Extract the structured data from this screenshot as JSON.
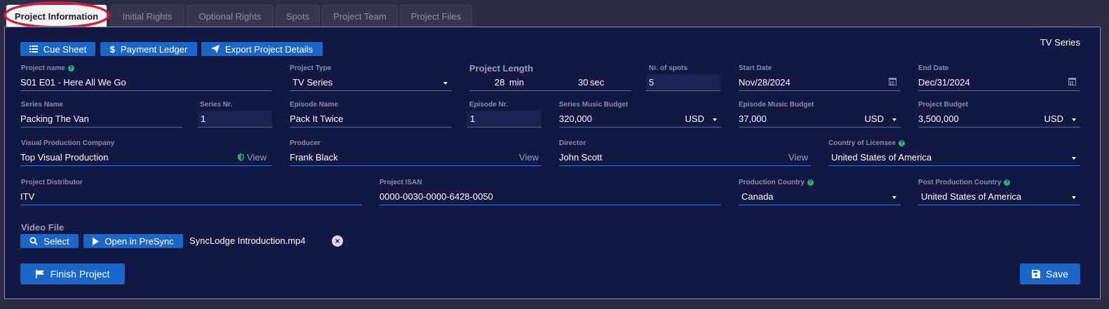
{
  "tabs": [
    {
      "label": "Project Information",
      "active": true
    },
    {
      "label": "Initial Rights"
    },
    {
      "label": "Optional Rights"
    },
    {
      "label": "Spots"
    },
    {
      "label": "Project Team"
    },
    {
      "label": "Project Files"
    }
  ],
  "toolbar": {
    "cue_sheet": "Cue Sheet",
    "payment_ledger": "Payment Ledger",
    "export": "Export Project Details"
  },
  "project_kind": "TV Series",
  "fields": {
    "project_name": {
      "label": "Project name",
      "value": "S01 E01 - Here All We Go"
    },
    "project_type": {
      "label": "Project Type",
      "value": "TV Series"
    },
    "project_length": {
      "label": "Project Length",
      "minutes": "28",
      "min_unit": "min",
      "seconds": "30",
      "sec_unit": "sec"
    },
    "nr_spots": {
      "label": "Nr. of spots",
      "value": "5"
    },
    "start_date": {
      "label": "Start Date",
      "value": "Nov/28/2024"
    },
    "end_date": {
      "label": "End Date",
      "value": "Dec/31/2024"
    },
    "series_name": {
      "label": "Series Name",
      "value": "Packing The Van"
    },
    "series_nr": {
      "label": "Series Nr.",
      "value": "1"
    },
    "episode_name": {
      "label": "Episode Name",
      "value": "Pack It Twice"
    },
    "episode_nr": {
      "label": "Episode Nr.",
      "value": "1"
    },
    "series_music_budget": {
      "label": "Series Music Budget",
      "value": "320,000",
      "currency": "USD"
    },
    "episode_music_budget": {
      "label": "Episode Music Budget",
      "value": "37,000",
      "currency": "USD"
    },
    "project_budget": {
      "label": "Project Budget",
      "value": "3,500,000",
      "currency": "USD"
    },
    "visual_production_company": {
      "label": "Visual Production Company",
      "value": "Top Visual Production",
      "action": "View"
    },
    "producer": {
      "label": "Producer",
      "value": "Frank Black",
      "action": "View"
    },
    "director": {
      "label": "Director",
      "value": "John Scott",
      "action": "View"
    },
    "country_of_licensee": {
      "label": "Country of Licensee",
      "value": "United States of America"
    },
    "project_distributor": {
      "label": "Project Distributor",
      "value": "ITV"
    },
    "project_isan": {
      "label": "Project ISAN",
      "value": "0000-0030-0000-6428-0050"
    },
    "production_country": {
      "label": "Production Country",
      "value": "Canada"
    },
    "post_production_country": {
      "label": "Post Production Country",
      "value": "United States of America"
    }
  },
  "video": {
    "label": "Video File",
    "select": "Select",
    "open": "Open in PreSync",
    "filename": "SyncLodge Introduction.mp4"
  },
  "footer": {
    "finish": "Finish Project",
    "save": "Save"
  },
  "colors": {
    "accent": "#1a67c9",
    "panel": "#111844",
    "highlight_ring": "#d11d3c",
    "help": "#2db46f"
  }
}
